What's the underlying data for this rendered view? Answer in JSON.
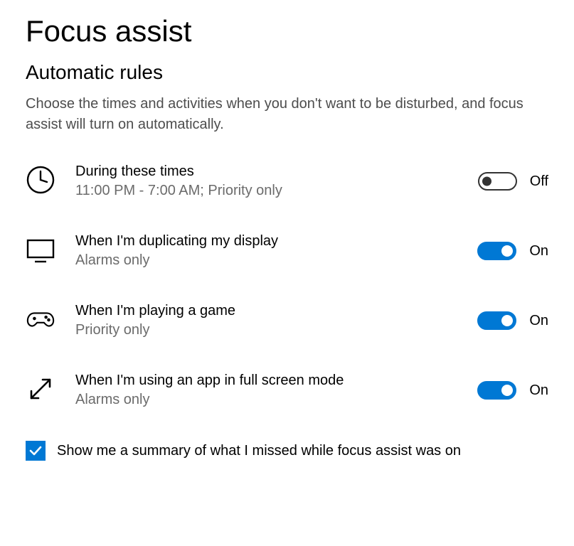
{
  "page_title": "Focus assist",
  "section_heading": "Automatic rules",
  "section_description": "Choose the times and activities when you don't want to be disturbed, and focus assist will turn on automatically.",
  "rules": [
    {
      "icon": "clock",
      "title": "During these times",
      "subtitle": "11:00 PM - 7:00 AM; Priority only",
      "enabled": false,
      "state_label": "Off"
    },
    {
      "icon": "monitor",
      "title": "When I'm duplicating my display",
      "subtitle": "Alarms only",
      "enabled": true,
      "state_label": "On"
    },
    {
      "icon": "gamepad",
      "title": "When I'm playing a game",
      "subtitle": "Priority only",
      "enabled": true,
      "state_label": "On"
    },
    {
      "icon": "fullscreen",
      "title": "When I'm using an app in full screen mode",
      "subtitle": "Alarms only",
      "enabled": true,
      "state_label": "On"
    }
  ],
  "summary_checkbox": {
    "checked": true,
    "label": "Show me a summary of what I missed while focus assist was on"
  },
  "colors": {
    "accent": "#0078d4"
  }
}
